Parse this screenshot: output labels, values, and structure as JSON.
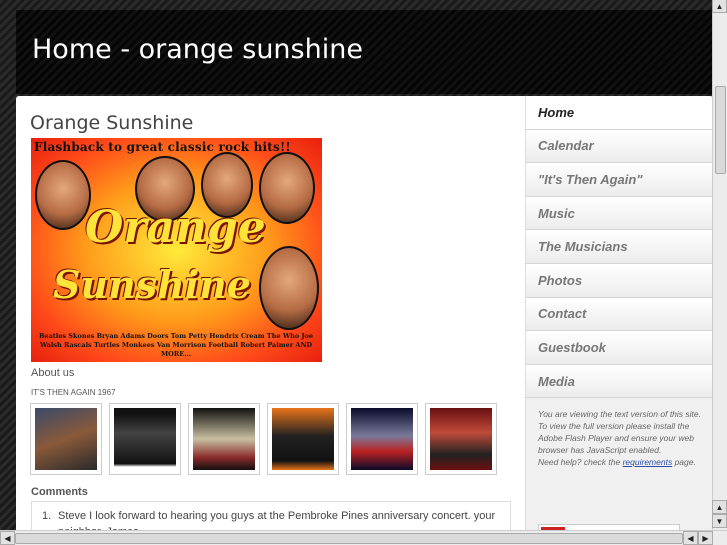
{
  "header": {
    "title": "Home - orange sunshine"
  },
  "main": {
    "page_title": "Orange Sunshine",
    "banner": {
      "tagline": "Flashback to great classic rock hits!!",
      "word1": "Orange",
      "word2": "Sunshine",
      "band_list": "Beatles Skones Bryan Adams Doors Tom Petty Hendrix Cream The Who Joe Walsh Rascals Turtles Monkees Van Morrison Football Robert Palmer AND MORE..."
    },
    "about_label": "About us",
    "album_title": "IT'S THEN AGAIN 1967",
    "comments_heading": "Comments",
    "comments": [
      {
        "number": "1.",
        "text": "Steve I look forward to hearing you guys at the Pembroke Pines anniversary concert. your neighbor, James"
      }
    ]
  },
  "sidebar": {
    "items": [
      {
        "label": "Home",
        "active": true
      },
      {
        "label": "Calendar",
        "active": false
      },
      {
        "label": "\"It's Then Again\"",
        "active": false
      },
      {
        "label": "Music",
        "active": false
      },
      {
        "label": "The Musicians",
        "active": false
      },
      {
        "label": "Photos",
        "active": false
      },
      {
        "label": "Contact",
        "active": false
      },
      {
        "label": "Guestbook",
        "active": false
      },
      {
        "label": "Media",
        "active": false
      }
    ],
    "notice": {
      "line1": "You are viewing the text version of this site.",
      "line2": "To view the full version please install the Adobe Flash Player and ensure your web browser has JavaScript enabled.",
      "line3_prefix": "Need help? check the ",
      "line3_link": "requirements",
      "line3_suffix": " page."
    }
  },
  "colors": {
    "accent_orange": "#ff7a1a",
    "link_blue": "#2a4fa8",
    "header_bg": "#0b0b0b"
  }
}
